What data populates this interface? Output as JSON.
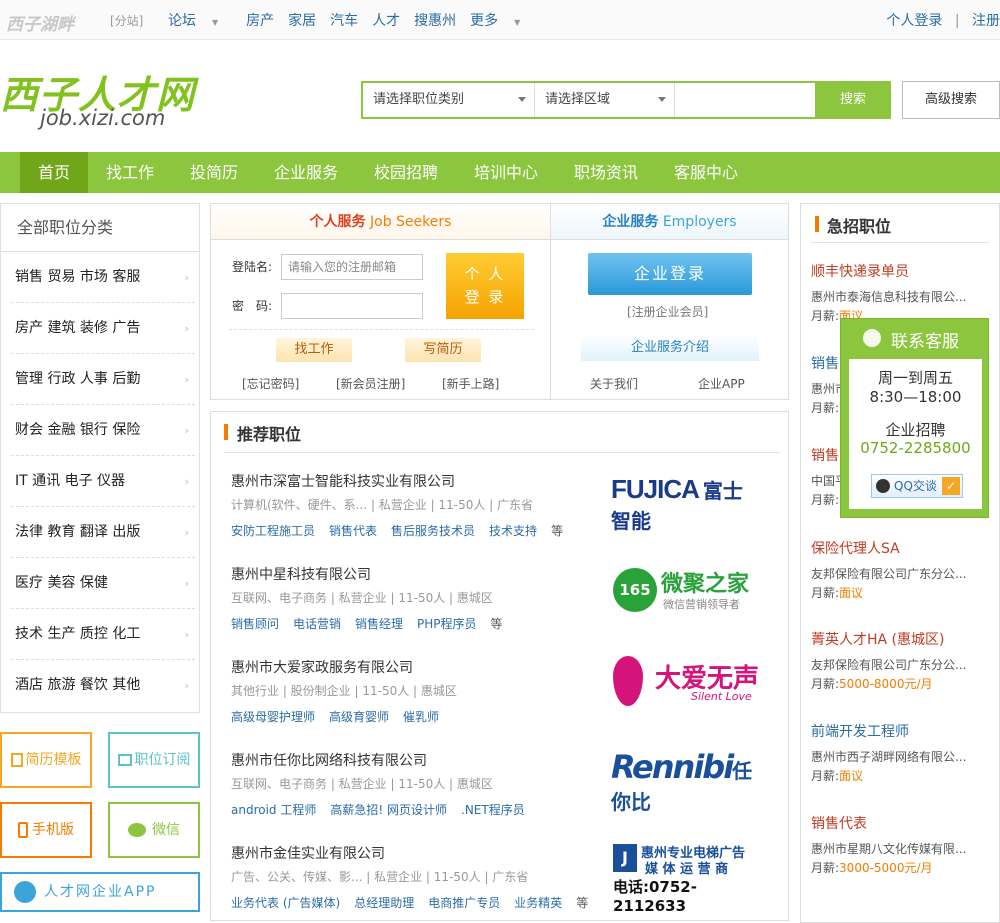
{
  "topbar": {
    "logo": "西子湖畔",
    "substation": "[分站]",
    "nav": [
      {
        "label": "论坛",
        "dropdown": true
      },
      {
        "label": "房产",
        "dropdown": false
      },
      {
        "label": "家居",
        "dropdown": false
      },
      {
        "label": "汽车",
        "dropdown": false
      },
      {
        "label": "人才",
        "dropdown": false
      },
      {
        "label": "搜惠州",
        "dropdown": false
      },
      {
        "label": "更多",
        "dropdown": true
      }
    ],
    "login": "个人登录",
    "separator": "|",
    "register": "注册"
  },
  "header": {
    "brand_cn": "西子人才网",
    "brand_en": "job.xizi.com",
    "search": {
      "job_category": "请选择职位类别",
      "region": "请选择区域",
      "keyword": "",
      "search_button": "搜索",
      "advanced_button": "高级搜索"
    }
  },
  "mainnav": [
    "首页",
    "找工作",
    "投简历",
    "企业服务",
    "校园招聘",
    "培训中心",
    "职场资讯",
    "客服中心"
  ],
  "categories": {
    "title": "全部职位分类",
    "rows": [
      "销售 贸易 市场 客服",
      "房产 建筑 装修 广告",
      "管理 行政 人事 后勤",
      "财会 金融 银行 保险",
      "IT 通讯 电子 仪器",
      "法律 教育 翻译 出版",
      "医疗 美容 保健",
      "技术 生产 质控 化工",
      "酒店 旅游 餐饮 其他"
    ]
  },
  "quick_links": {
    "resume_template": "简历模板",
    "job_subscribe": "职位订阅",
    "mobile": "手机版",
    "wechat": "微信",
    "app": "人才网企业APP"
  },
  "personal": {
    "title_cn": "个人服务",
    "title_en": "Job Seekers",
    "username_label": "登陆名:",
    "username_placeholder": "请输入您的注册邮箱",
    "password_label": "密　码:",
    "login_button_line1": "个 人",
    "login_button_line2": "登 录",
    "find_job": "找工作",
    "write_resume": "写简历",
    "forgot_password": "[忘记密码]",
    "new_register": "[新会员注册]",
    "new_guide": "[新手上路]"
  },
  "enterprise": {
    "title_cn": "企业服务",
    "title_en": "Employers",
    "login_button": "企业登录",
    "register": "[注册企业会员]",
    "intro": "企业服务介绍",
    "about": "关于我们",
    "app": "企业APP"
  },
  "recommend": {
    "title": "推荐职位",
    "items": [
      {
        "company": "惠州市深富士智能科技实业有限公司",
        "meta": "计算机(软件、硬件、系...  |  私营企业  |  11-50人  |  广东省",
        "jobs": [
          "安防工程施工员",
          "销售代表",
          "售后服务技术员",
          "技术支持"
        ],
        "more": "等",
        "logo_a": "FUJICA",
        "logo_b": "富士智能",
        "logo_color": "#1a3a8a"
      },
      {
        "company": "惠州中星科技有限公司",
        "meta": "互联网、电子商务  |  私营企业  |  11-50人  |  惠城区",
        "jobs": [
          "销售顾问",
          "电话营销",
          "销售经理",
          "PHP程序员"
        ],
        "more": "等",
        "logo_a": "165",
        "logo_b": "微聚之家",
        "logo_sub": "微信营销领导者",
        "logo_color": "#2aa23a"
      },
      {
        "company": "惠州市大爱家政服务有限公司",
        "meta": "其他行业  |  股份制企业  |  11-50人  |  惠城区",
        "jobs": [
          "高级母婴护理师",
          "高级育婴师",
          "催乳师"
        ],
        "more": "",
        "logo_b": "大爱无声",
        "logo_sub": "Silent Love",
        "logo_color": "#d4147a"
      },
      {
        "company": "惠州市任你比网络科技有限公司",
        "meta": "互联网、电子商务  |  私营企业  |  11-50人  |  惠城区",
        "jobs": [
          "android 工程师",
          "高薪急招! 网页设计师",
          ".NET程序员"
        ],
        "more": "",
        "logo_a": "Rennibi",
        "logo_b": "任你比",
        "logo_color": "#1a4f9c"
      },
      {
        "company": "惠州市金佳实业有限公司",
        "meta": "广告、公关、传媒、影...  |  私营企业  |  11-50人  |  广东省",
        "jobs": [
          "业务代表 (广告媒体)",
          "总经理助理",
          "电商推广专员",
          "业务精英"
        ],
        "more": "等",
        "logo_a": "惠州专业电梯广告",
        "logo_b": "媒 体 运 营 商",
        "logo_sub": "电话:0752-2112633",
        "logo_color": "#1a4f9c"
      }
    ]
  },
  "urgent": {
    "title": "急招职位",
    "salary_label": "月薪:",
    "items": [
      {
        "job": "顺丰快递录单员",
        "company": "惠州市泰海信息科技有限公...",
        "salary": "面议"
      },
      {
        "job": "销售...",
        "company": "惠州市...",
        "salary": ""
      },
      {
        "job": "销售...",
        "company": "中国平...",
        "salary": ""
      },
      {
        "job": "保险代理人SA",
        "company": "友邦保险有限公司广东分公...",
        "salary": "面议"
      },
      {
        "job": "菁英人才HA (惠城区)",
        "company": "友邦保险有限公司广东分公...",
        "salary": "5000-8000元/月"
      },
      {
        "job": "前端开发工程师",
        "company": "惠州市西子湖畔网络有限公...",
        "salary": "面议"
      },
      {
        "job": "销售代表",
        "company": "惠州市星期八文化传媒有限...",
        "salary": "3000-5000元/月"
      }
    ]
  },
  "contact": {
    "title": "联系客服",
    "hours_line1": "周一到周五",
    "hours_line2": "8:30—18:00",
    "biz_label": "企业招聘",
    "phone": "0752-2285800",
    "qq": "QQ交谈"
  },
  "colors": {
    "brand_green": "#8cc63f",
    "nav_active": "#6fa61a",
    "link_blue": "#2a6ca8",
    "accent_orange": "#f57c00",
    "urgent_red": "#c23b22"
  }
}
